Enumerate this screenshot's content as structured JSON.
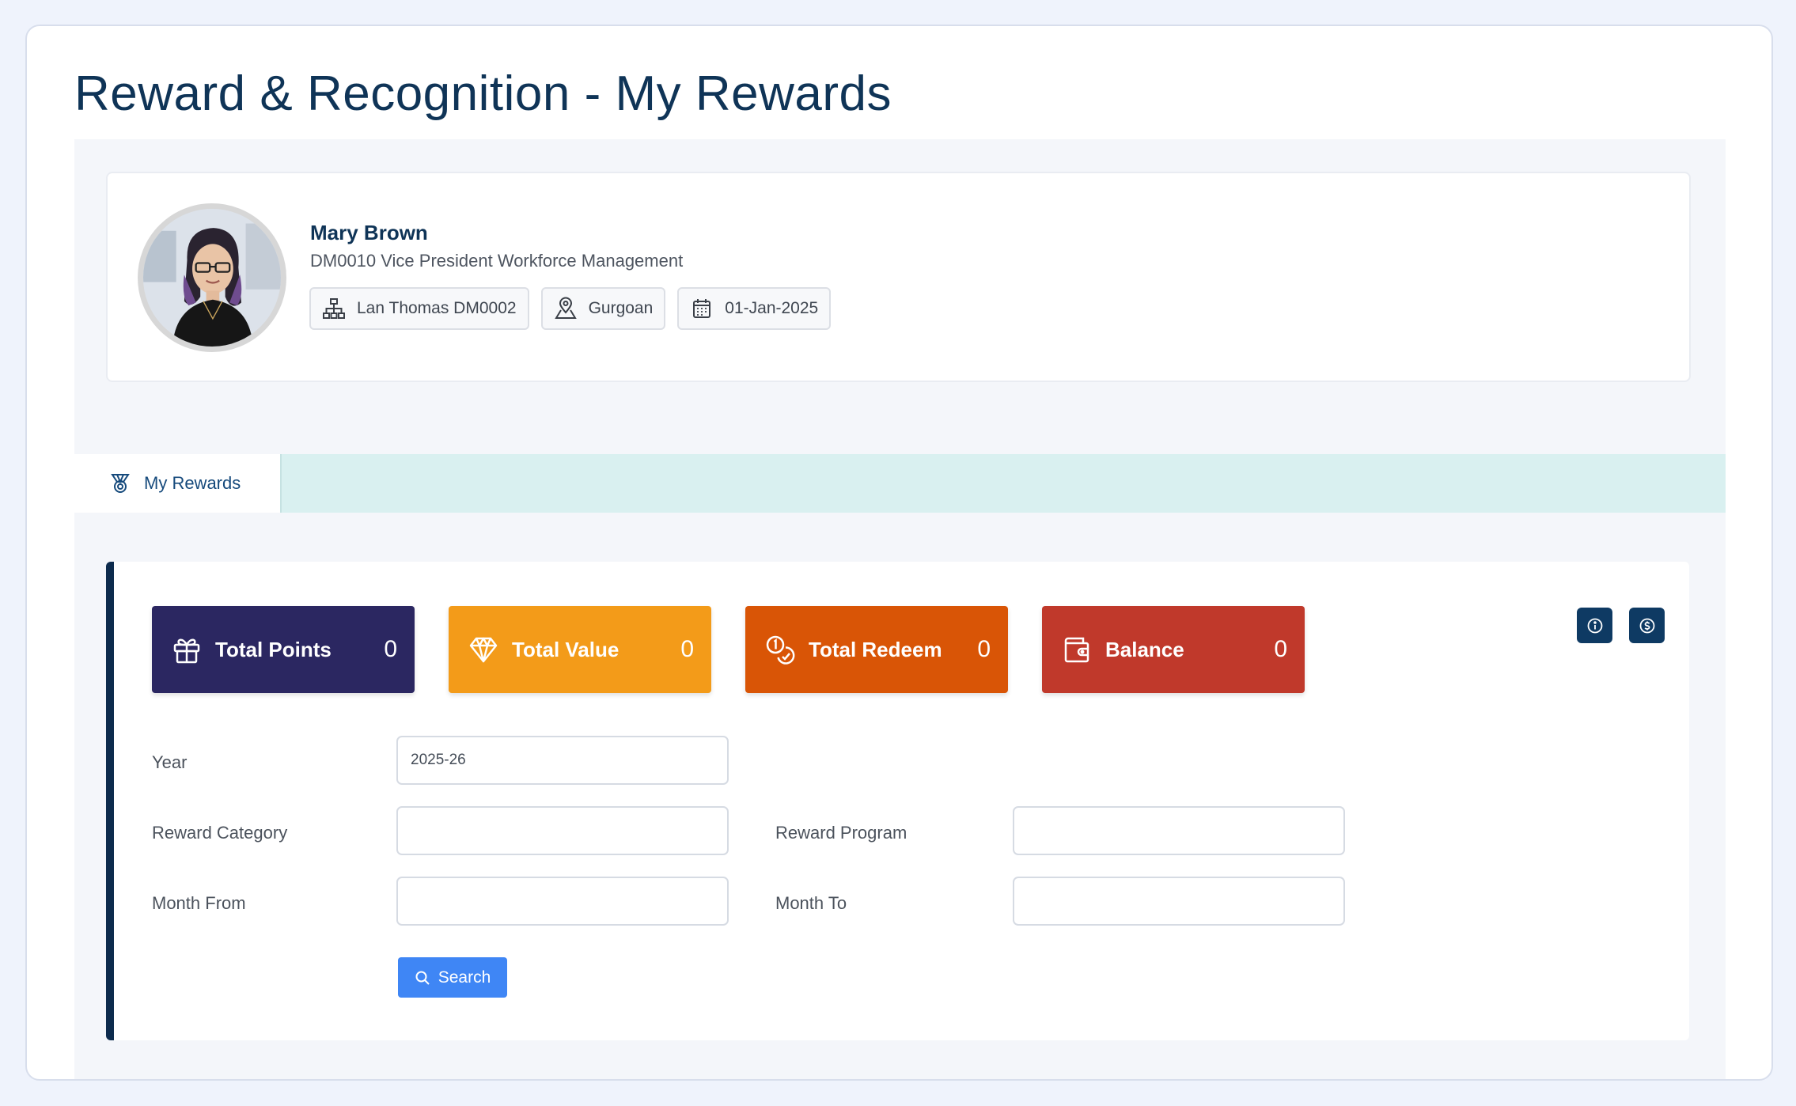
{
  "page": {
    "title": "Reward & Recognition - My Rewards"
  },
  "profile": {
    "name": "Mary Brown",
    "role": "DM0010 Vice President Workforce Management",
    "chips": {
      "manager": {
        "icon": "org-chart-icon",
        "label": "Lan Thomas DM0002"
      },
      "location": {
        "icon": "map-pin-icon",
        "label": "Gurgoan"
      },
      "date": {
        "icon": "calendar-icon",
        "label": "01-Jan-2025"
      }
    }
  },
  "tabs": [
    {
      "label": "My Rewards",
      "icon": "medal-icon",
      "active": true
    }
  ],
  "stats": [
    {
      "label": "Total Points",
      "value": "0",
      "icon": "gift-icon",
      "color": "#2b2761"
    },
    {
      "label": "Total Value",
      "value": "0",
      "icon": "diamond-icon",
      "color": "#f39b19"
    },
    {
      "label": "Total Redeem",
      "value": "0",
      "icon": "coins-icon",
      "color": "#d95506"
    },
    {
      "label": "Balance",
      "value": "0",
      "icon": "wallet-icon",
      "color": "#c0392b"
    }
  ],
  "actions": {
    "info_icon": "info-icon",
    "currency_icon": "dollar-circle-icon",
    "color": "#0e3a63"
  },
  "filters": {
    "year": {
      "label": "Year",
      "value": "2025-26"
    },
    "reward_category": {
      "label": "Reward Category",
      "value": ""
    },
    "reward_program": {
      "label": "Reward Program",
      "value": ""
    },
    "month_from": {
      "label": "Month From",
      "value": ""
    },
    "month_to": {
      "label": "Month To",
      "value": ""
    }
  },
  "search": {
    "label": "Search",
    "icon": "search-icon",
    "color": "#3f86f5"
  }
}
